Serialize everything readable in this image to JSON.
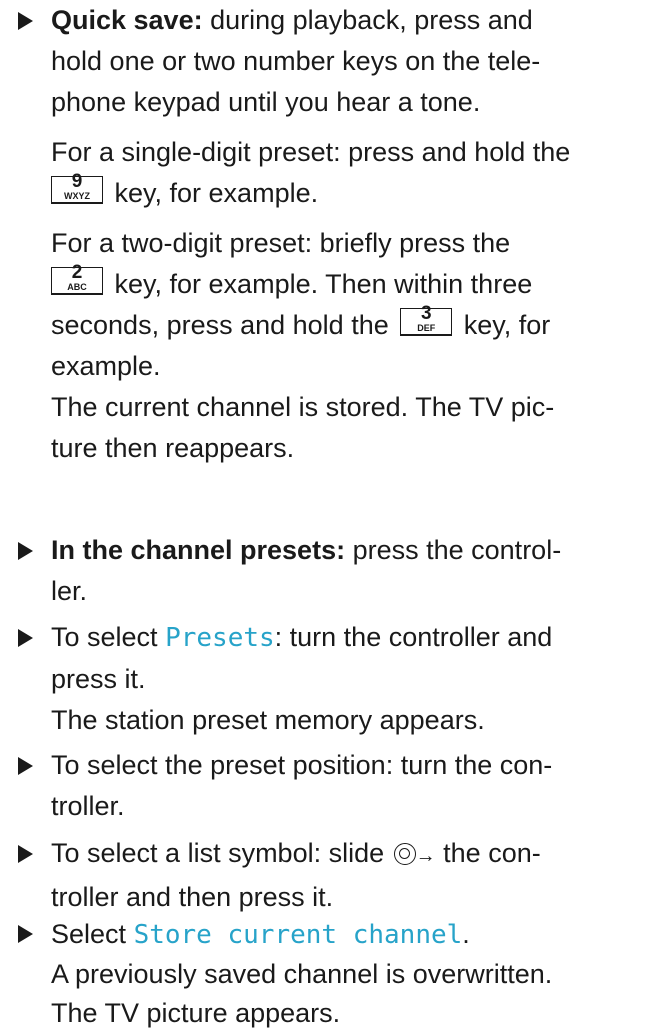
{
  "quick_save": {
    "heading": "Quick save:",
    "l1": "during playback, press and",
    "l2": "hold one or two number keys on the tele-",
    "l3": "phone keypad until you hear a tone.",
    "single_l1": "For a single-digit preset: press and hold the",
    "single_l2_after": "key, for example.",
    "two_l1": "For a two-digit preset: briefly press the",
    "two_l2_after": "key, for example. Then within three",
    "two_l3_before": "seconds, press and hold the",
    "two_l3_after": "key, for",
    "two_l4": "example.",
    "result_l1": "The current channel is stored. The TV pic-",
    "result_l2": "ture then reappears."
  },
  "keys": {
    "k9": {
      "digit": "9",
      "letters": "WXYZ"
    },
    "k2": {
      "digit": "2",
      "letters": "ABC"
    },
    "k3": {
      "digit": "3",
      "letters": "DEF"
    }
  },
  "in_presets": {
    "heading": "In the channel presets:",
    "l1": "press the control-",
    "l2": "ler."
  },
  "select_presets": {
    "before": "To select",
    "menu": "Presets",
    "after": ": turn the controller and",
    "l2": "press it.",
    "l3": "The station preset memory appears."
  },
  "select_position": {
    "l1": "To select the preset position: turn the con-",
    "l2": "troller."
  },
  "select_symbol": {
    "before": "To select a list symbol: slide",
    "arrow": "→",
    "after": "the con-",
    "l2": "troller and then press it."
  },
  "store": {
    "before": "Select",
    "menu": "Store current channel",
    "after": ".",
    "l2": "A previously saved channel is overwritten.",
    "l3": "The TV picture appears."
  }
}
